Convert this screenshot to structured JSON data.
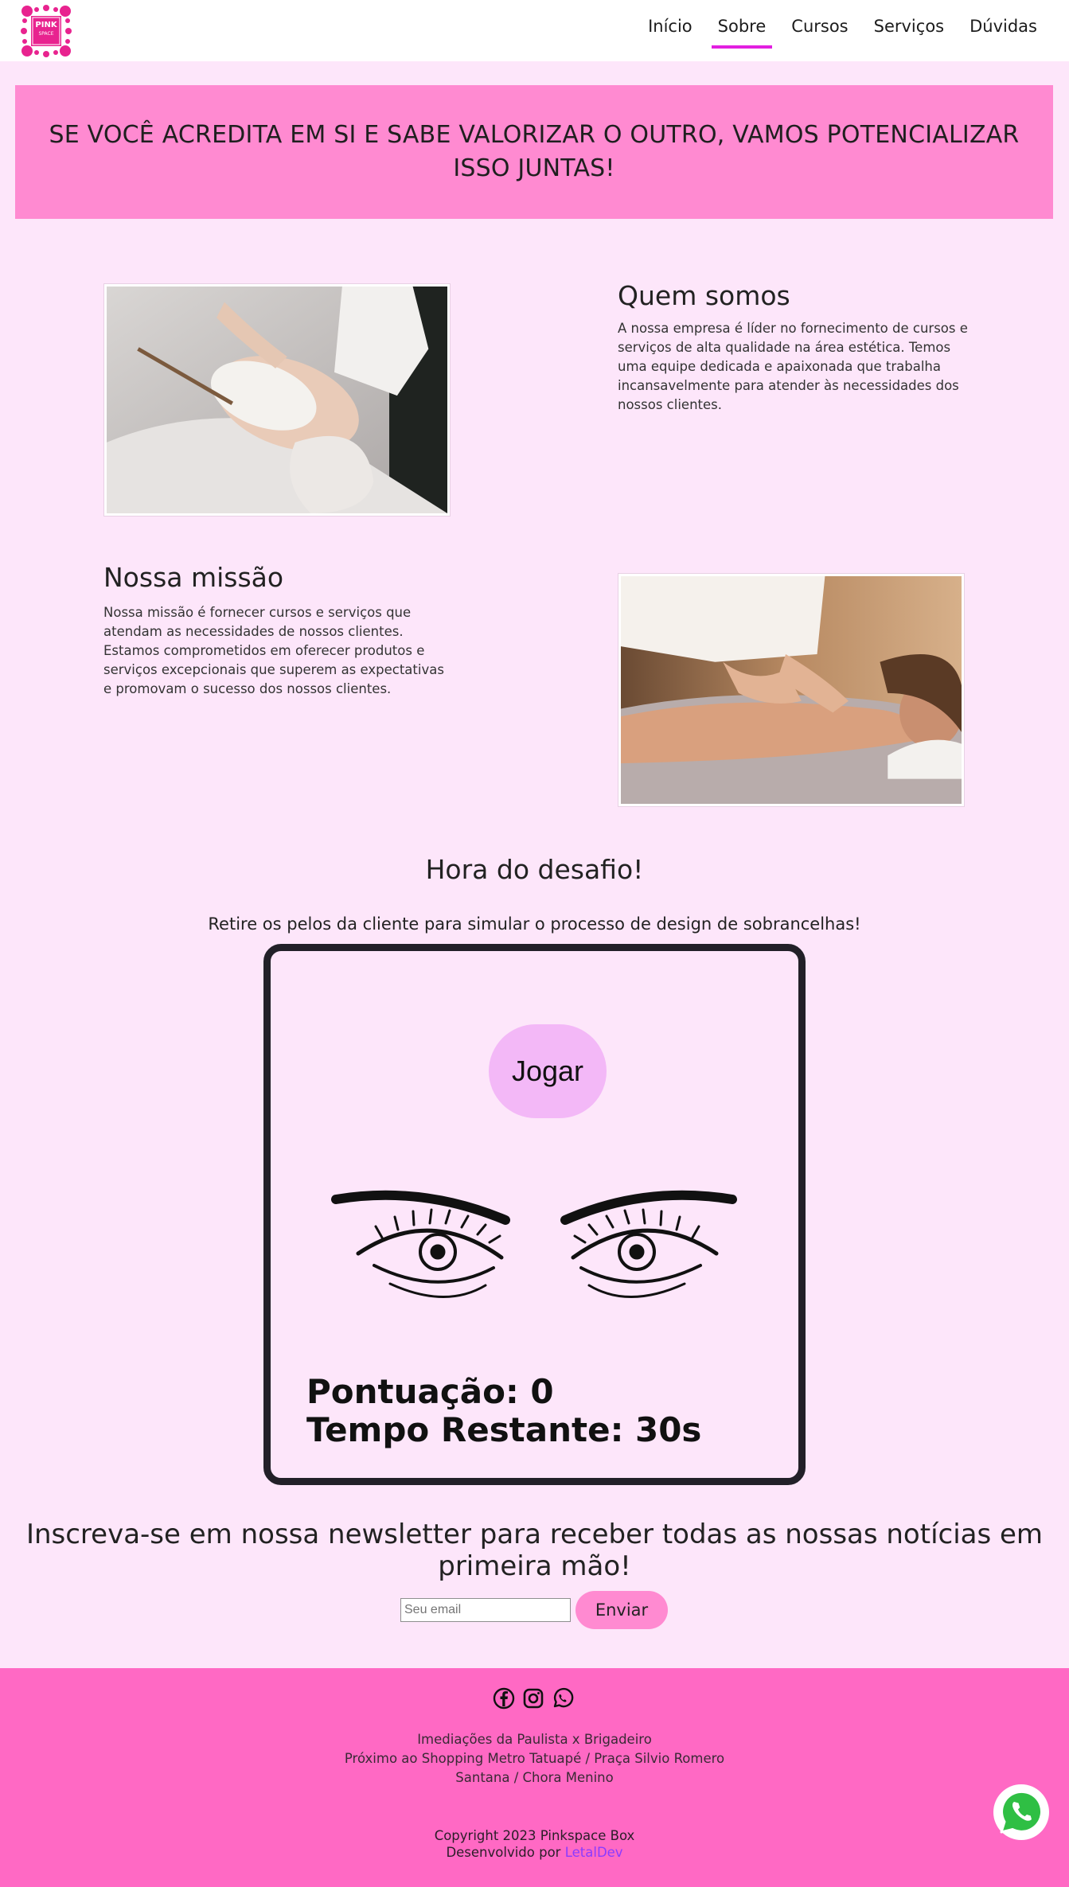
{
  "logo": {
    "line1": "PINK",
    "line2": "SPACE"
  },
  "nav": {
    "links": [
      {
        "label": "Início"
      },
      {
        "label": "Sobre"
      },
      {
        "label": "Cursos"
      },
      {
        "label": "Serviços"
      },
      {
        "label": "Dúvidas"
      }
    ],
    "active": "Sobre"
  },
  "banner": {
    "text": "SE VOCÊ ACREDITA EM SI E SABE VALORIZAR O OUTRO, VAMOS POTENCIALIZAR ISSO JUNTAS!"
  },
  "about": {
    "title": "Quem somos",
    "text": "A nossa empresa é líder no fornecimento de cursos e serviços de alta qualidade na área estética. Temos uma equipe dedicada e apaixonada que trabalha incansavelmente para atender às necessidades dos nossos clientes."
  },
  "mission": {
    "title": "Nossa missão",
    "text": "Nossa missão é fornecer cursos e serviços que atendam as necessidades de nossos clientes. Estamos comprometidos em oferecer produtos e serviços excepcionais que superem as expectativas e promovam o sucesso dos nossos clientes."
  },
  "challenge": {
    "title": "Hora do desafio!",
    "subtitle": "Retire os pelos da cliente para simular o processo de design de sobrancelhas!",
    "play_label": "Jogar",
    "score_text": "Pontuação: 0",
    "time_text": "Tempo Restante: 30s"
  },
  "newsletter": {
    "title": "Inscreva-se em nossa newsletter para receber todas as nossas notícias em primeira mão!",
    "placeholder": "Seu email",
    "button_label": "Enviar"
  },
  "footer": {
    "address": [
      "Imediações da Paulista x Brigadeiro",
      "Próximo ao Shopping Metro Tatuapé / Praça Silvio Romero",
      "Santana / Chora Menino"
    ],
    "copyright": "Copyright 2023 Pinkspace Box",
    "developed_prefix": "Desenvolvido por",
    "developer": "LetalDev"
  },
  "icons": [
    "facebook-icon",
    "instagram-icon",
    "whatsapp-icon",
    "whatsapp-float-icon"
  ],
  "colors": {
    "accent": "#e21fe0",
    "banner": "#ff8ad1",
    "footer": "#ff69c4",
    "background": "#fde6fa",
    "play_button": "#f3b8f7"
  }
}
